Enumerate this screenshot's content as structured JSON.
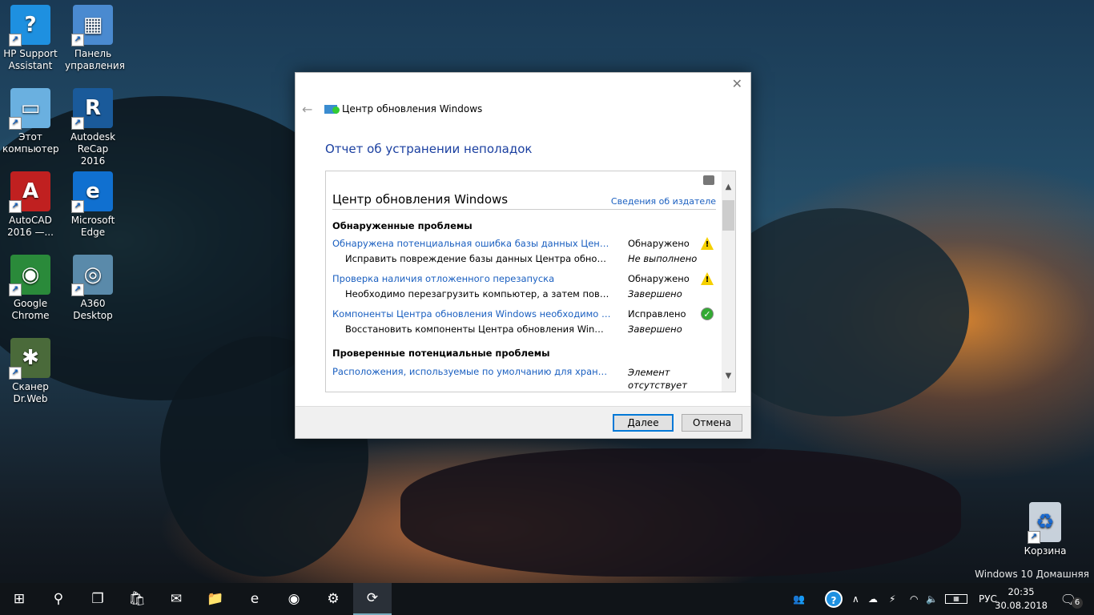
{
  "desktop": {
    "icons": [
      {
        "label": "HP Support Assistant",
        "glyph": "?",
        "color": "#1e90e0"
      },
      {
        "label": "Панель управления",
        "glyph": "▦",
        "color": "#4a8ad0"
      },
      {
        "label": "Этот компьютер",
        "glyph": "▭",
        "color": "#6ab0e0"
      },
      {
        "label": "Autodesk ReCap 2016",
        "glyph": "R",
        "color": "#1a5a9a"
      },
      {
        "label": "AutoCAD 2016 —...",
        "glyph": "A",
        "color": "#c02020"
      },
      {
        "label": "Microsoft Edge",
        "glyph": "e",
        "color": "#1070d0"
      },
      {
        "label": "Google Chrome",
        "glyph": "◉",
        "color": "#2a8a3a"
      },
      {
        "label": "A360 Desktop",
        "glyph": "◎",
        "color": "#5a8aaa"
      },
      {
        "label": "Сканер Dr.Web",
        "glyph": "✱",
        "color": "#4a6a3a"
      }
    ],
    "recycle_bin": "Корзина",
    "watermark": "Windows 10 Домашняя"
  },
  "dialog": {
    "close_glyph": "✕",
    "back_glyph": "←",
    "window_title": "Центр обновления Windows",
    "heading": "Отчет об устранении неполадок",
    "report": {
      "title": "Центр обновления Windows",
      "publisher_link": "Сведения об издателе",
      "section1": "Обнаруженные проблемы",
      "rows": [
        {
          "name": "Обнаружена потенциальная ошибка базы данных Центра обновления Windows",
          "status": "Обнаружено",
          "icon": "warning"
        },
        {
          "name": "Исправить повреждение базы данных Центра обновления Windows",
          "status": "Не выполнено"
        },
        {
          "name": "Проверка наличия отложенного перезапуска",
          "status": "Обнаружено",
          "icon": "warning"
        },
        {
          "name": "Необходимо перезагрузить компьютер, а затем повторить попытку",
          "status": "Завершено"
        },
        {
          "name": "Компоненты Центра обновления Windows необходимо восстановить",
          "status": "Исправлено",
          "icon": "check"
        },
        {
          "name": "Восстановить компоненты Центра обновления Windows",
          "status": "Завершено"
        }
      ],
      "section2": "Проверенные потенциальные проблемы",
      "row2": {
        "name": "Расположения, используемые по умолчанию для хранения",
        "status_line1": "Элемент",
        "status_line2": "отсутствует"
      }
    },
    "next_button": "Далее",
    "cancel_button": "Отмена"
  },
  "taskbar": {
    "apps": [
      "start",
      "search",
      "task-view",
      "store",
      "mail",
      "file-explorer",
      "edge",
      "chrome",
      "settings",
      "windows-update-troubleshooter"
    ],
    "language": "РУС",
    "time": "20:35",
    "date": "30.08.2018",
    "notifications_count": "6"
  }
}
